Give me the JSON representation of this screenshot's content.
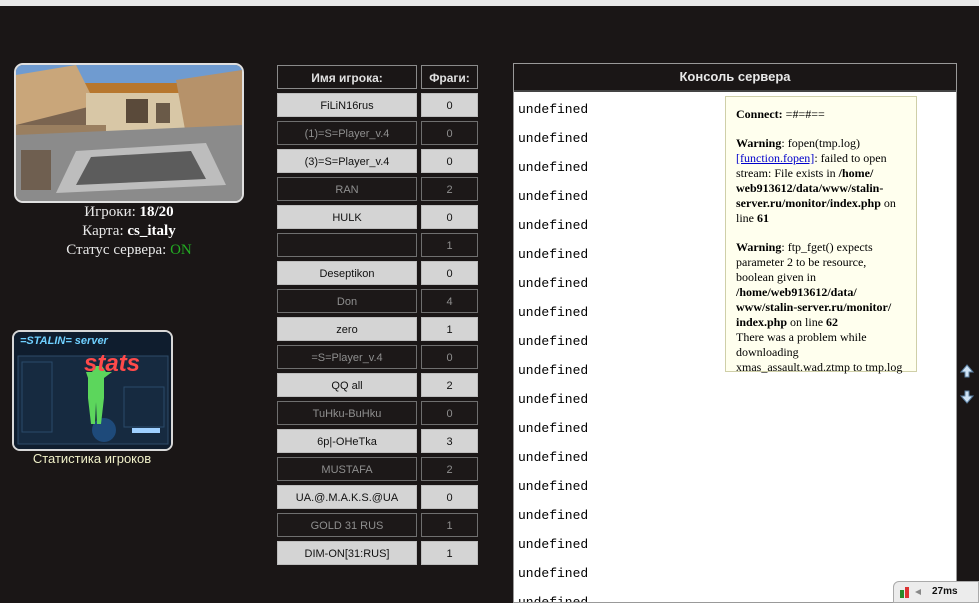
{
  "server": {
    "players_label": "Игроки:",
    "players_value": "18/20",
    "map_label": "Карта:",
    "map_value": "cs_italy",
    "status_label": "Статус сервера:",
    "status_value": "ON"
  },
  "stats": {
    "banner_top": "=STALIN= server",
    "banner_big": "stats",
    "label": "Статистика игроков"
  },
  "players_table": {
    "headers": [
      "Имя игрока:",
      "Фраги:"
    ],
    "rows": [
      {
        "name": "FiLiN16rus",
        "frags": "0"
      },
      {
        "name": "(1)=S=Player_v.4",
        "frags": "0"
      },
      {
        "name": "(3)=S=Player_v.4",
        "frags": "0"
      },
      {
        "name": "RAN",
        "frags": "2"
      },
      {
        "name": "HULK",
        "frags": "0"
      },
      {
        "name": "",
        "frags": "1"
      },
      {
        "name": "Deseptikon",
        "frags": "0"
      },
      {
        "name": "Don",
        "frags": "4"
      },
      {
        "name": "zero",
        "frags": "1"
      },
      {
        "name": "=S=Player_v.4",
        "frags": "0"
      },
      {
        "name": "QQ all",
        "frags": "2"
      },
      {
        "name": "TuHku-BuHku",
        "frags": "0"
      },
      {
        "name": "6p|-OHeTka",
        "frags": "3"
      },
      {
        "name": "MUSTAFA",
        "frags": "2"
      },
      {
        "name": "UA.@.M.A.K.S.@UA",
        "frags": "0"
      },
      {
        "name": "GOLD 31 RUS",
        "frags": "1"
      },
      {
        "name": "DIM-ON[31:RUS]",
        "frags": "1"
      }
    ]
  },
  "console": {
    "title": "Консоль сервера",
    "lines": [
      "undefined",
      "undefined",
      "undefined",
      "undefined",
      "undefined",
      "undefined",
      "undefined",
      "undefined",
      "undefined",
      "undefined",
      "undefined",
      "undefined",
      "undefined",
      "undefined",
      "undefined",
      "undefined",
      "undefined",
      "undefined"
    ]
  },
  "warning_box": {
    "connect_label": "Connect:",
    "connect_value": "=#=#==",
    "w1_label": "Warning",
    "w1_text_a": ": fopen(tmp.log)",
    "w1_link": "[function.fopen]",
    "w1_text_b": ": failed to open stream: File exists in",
    "w1_path": "/home/ web913612/data/www/stalin-server.ru/monitor/index.php",
    "w1_line_label": "on line",
    "w1_line": "61",
    "w2_label": "Warning",
    "w2_text_a": ": ftp_fget() expects parameter 2 to be resource, boolean given in",
    "w2_path": "/home/web913612/data/ www/stalin-server.ru/monitor/ index.php",
    "w2_line_label": "on line",
    "w2_line": "62",
    "problem_text": "There was a problem while downloading xmas_assault.wad.ztmp to tmp.log"
  },
  "tray": {
    "ping": "27ms"
  },
  "icons": [
    "scroll-up-arrow-icon",
    "scroll-down-arrow-icon",
    "tray-app-icon",
    "tray-arrow-icon"
  ]
}
